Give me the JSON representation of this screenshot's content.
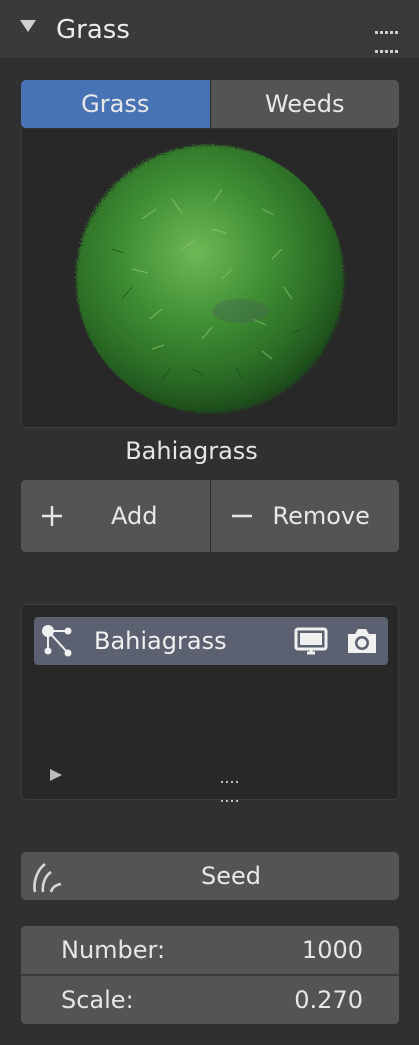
{
  "panel": {
    "title": "Grass",
    "icons": {
      "collapse": "disclosure-triangle-down-icon",
      "drag": "drag-grip-icon"
    }
  },
  "tabs": [
    {
      "label": "Grass",
      "active": true
    },
    {
      "label": "Weeds",
      "active": false
    }
  ],
  "preview": {
    "asset_name": "Bahiagrass"
  },
  "actions": {
    "add_label": "Add",
    "remove_label": "Remove",
    "add_icon": "plus-icon",
    "remove_icon": "minus-icon"
  },
  "list": {
    "items": [
      {
        "label": "Bahiagrass",
        "selected": true,
        "icons": [
          "particle-system-icon",
          "monitor-icon",
          "camera-icon"
        ]
      }
    ]
  },
  "seed": {
    "label": "Seed",
    "icon": "wind-arcs-icon"
  },
  "fields": [
    {
      "label": "Number:",
      "value": "1000"
    },
    {
      "label": "Scale:",
      "value": "0.270"
    }
  ],
  "colors": {
    "accent": "#4772b3",
    "panel_bg": "#303030",
    "header_bg": "#3a3a3a",
    "widget": "#545454",
    "selected_row": "#5b6170"
  }
}
